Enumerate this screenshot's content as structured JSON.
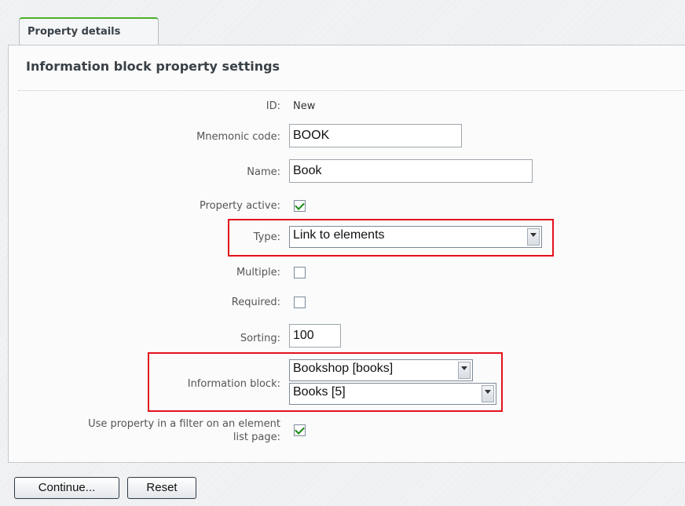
{
  "tab": {
    "label": "Property details"
  },
  "panel": {
    "title": "Information block property settings"
  },
  "fields": {
    "id": {
      "label": "ID:",
      "value": "New"
    },
    "mnemonic_code": {
      "label": "Mnemonic code:",
      "value": "BOOK"
    },
    "name": {
      "label": "Name:",
      "value": "Book"
    },
    "property_active": {
      "label": "Property active:",
      "checked": true
    },
    "type": {
      "label": "Type:",
      "selected": "Link to elements"
    },
    "multiple": {
      "label": "Multiple:",
      "checked": false
    },
    "required": {
      "label": "Required:",
      "checked": false
    },
    "sorting": {
      "label": "Sorting:",
      "value": "100"
    },
    "information_block": {
      "label": "Information block:",
      "type_selected": "Bookshop [books]",
      "block_selected": "Books [5]"
    },
    "use_in_filter": {
      "label_line1": "Use property in a filter on an element",
      "label_line2": "list page:",
      "checked": true
    }
  },
  "buttons": {
    "continue": "Continue...",
    "reset": "Reset"
  },
  "colors": {
    "highlight": "#e3121c",
    "tab_accent": "#4caf2a",
    "check": "#1a8a16"
  },
  "icons": {
    "dropdown": "chevron-down-icon",
    "checkmark": "checkmark-icon"
  }
}
